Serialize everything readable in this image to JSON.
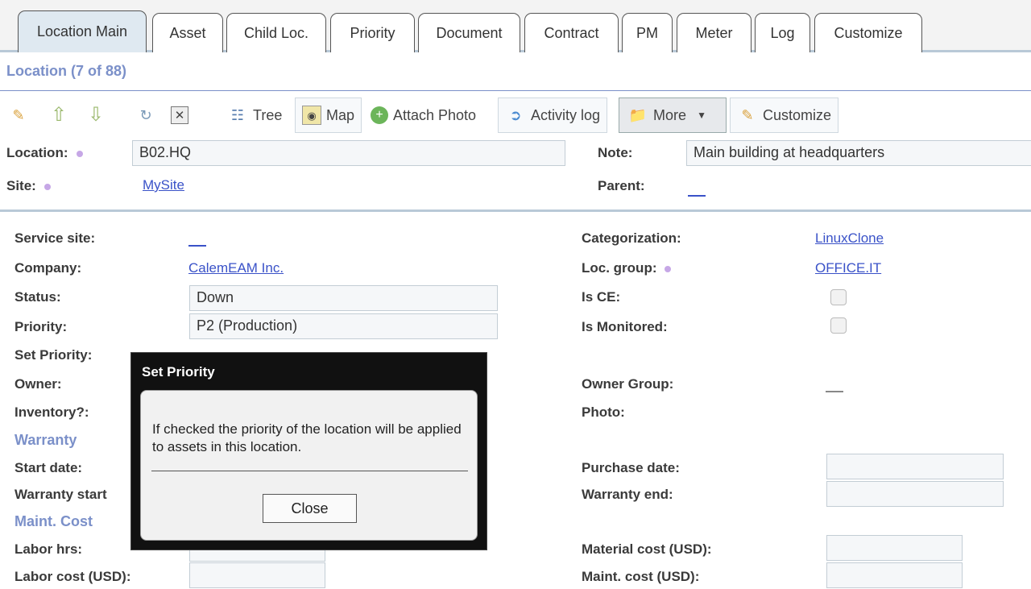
{
  "tabs": [
    "Location Main",
    "Asset",
    "Child Loc.",
    "Priority",
    "Document",
    "Contract",
    "PM",
    "Meter",
    "Log",
    "Customize"
  ],
  "title": "Location (7 of 88)",
  "toolbar": {
    "tree": "Tree",
    "map": "Map",
    "attach_photo": "Attach Photo",
    "activity_log": "Activity log",
    "more": "More",
    "customize": "Customize"
  },
  "header": {
    "location_label": "Location:",
    "location_value": "B02.HQ",
    "site_label": "Site:",
    "site_value": "MySite",
    "note_label": "Note:",
    "note_value": "Main building at headquarters",
    "parent_label": "Parent:"
  },
  "left": {
    "service_site": "Service site:",
    "company": "Company:",
    "company_value": "CalemEAM Inc.",
    "status": "Status:",
    "status_value": "Down",
    "priority": "Priority:",
    "priority_value": "P2 (Production)",
    "set_priority": "Set Priority:",
    "owner": "Owner:",
    "inventory": "Inventory?:",
    "warranty_section": "Warranty",
    "start_date": "Start date:",
    "warranty_start": "Warranty start",
    "maint_cost_section": "Maint. Cost",
    "labor_hrs": "Labor hrs:",
    "labor_cost": "Labor cost (USD):"
  },
  "right": {
    "categorization": "Categorization:",
    "categorization_value": "LinuxClone",
    "loc_group": "Loc. group:",
    "loc_group_value": "OFFICE.IT",
    "is_ce": "Is CE:",
    "is_monitored": "Is Monitored:",
    "owner_group": "Owner Group:",
    "photo": "Photo:",
    "purchase_date": "Purchase date:",
    "warranty_end": "Warranty end:",
    "material_cost": "Material cost (USD):",
    "maint_cost": "Maint. cost (USD):"
  },
  "modal": {
    "title": "Set Priority",
    "message": "If checked the priority of the location will be applied to assets in this location.",
    "close": "Close"
  }
}
